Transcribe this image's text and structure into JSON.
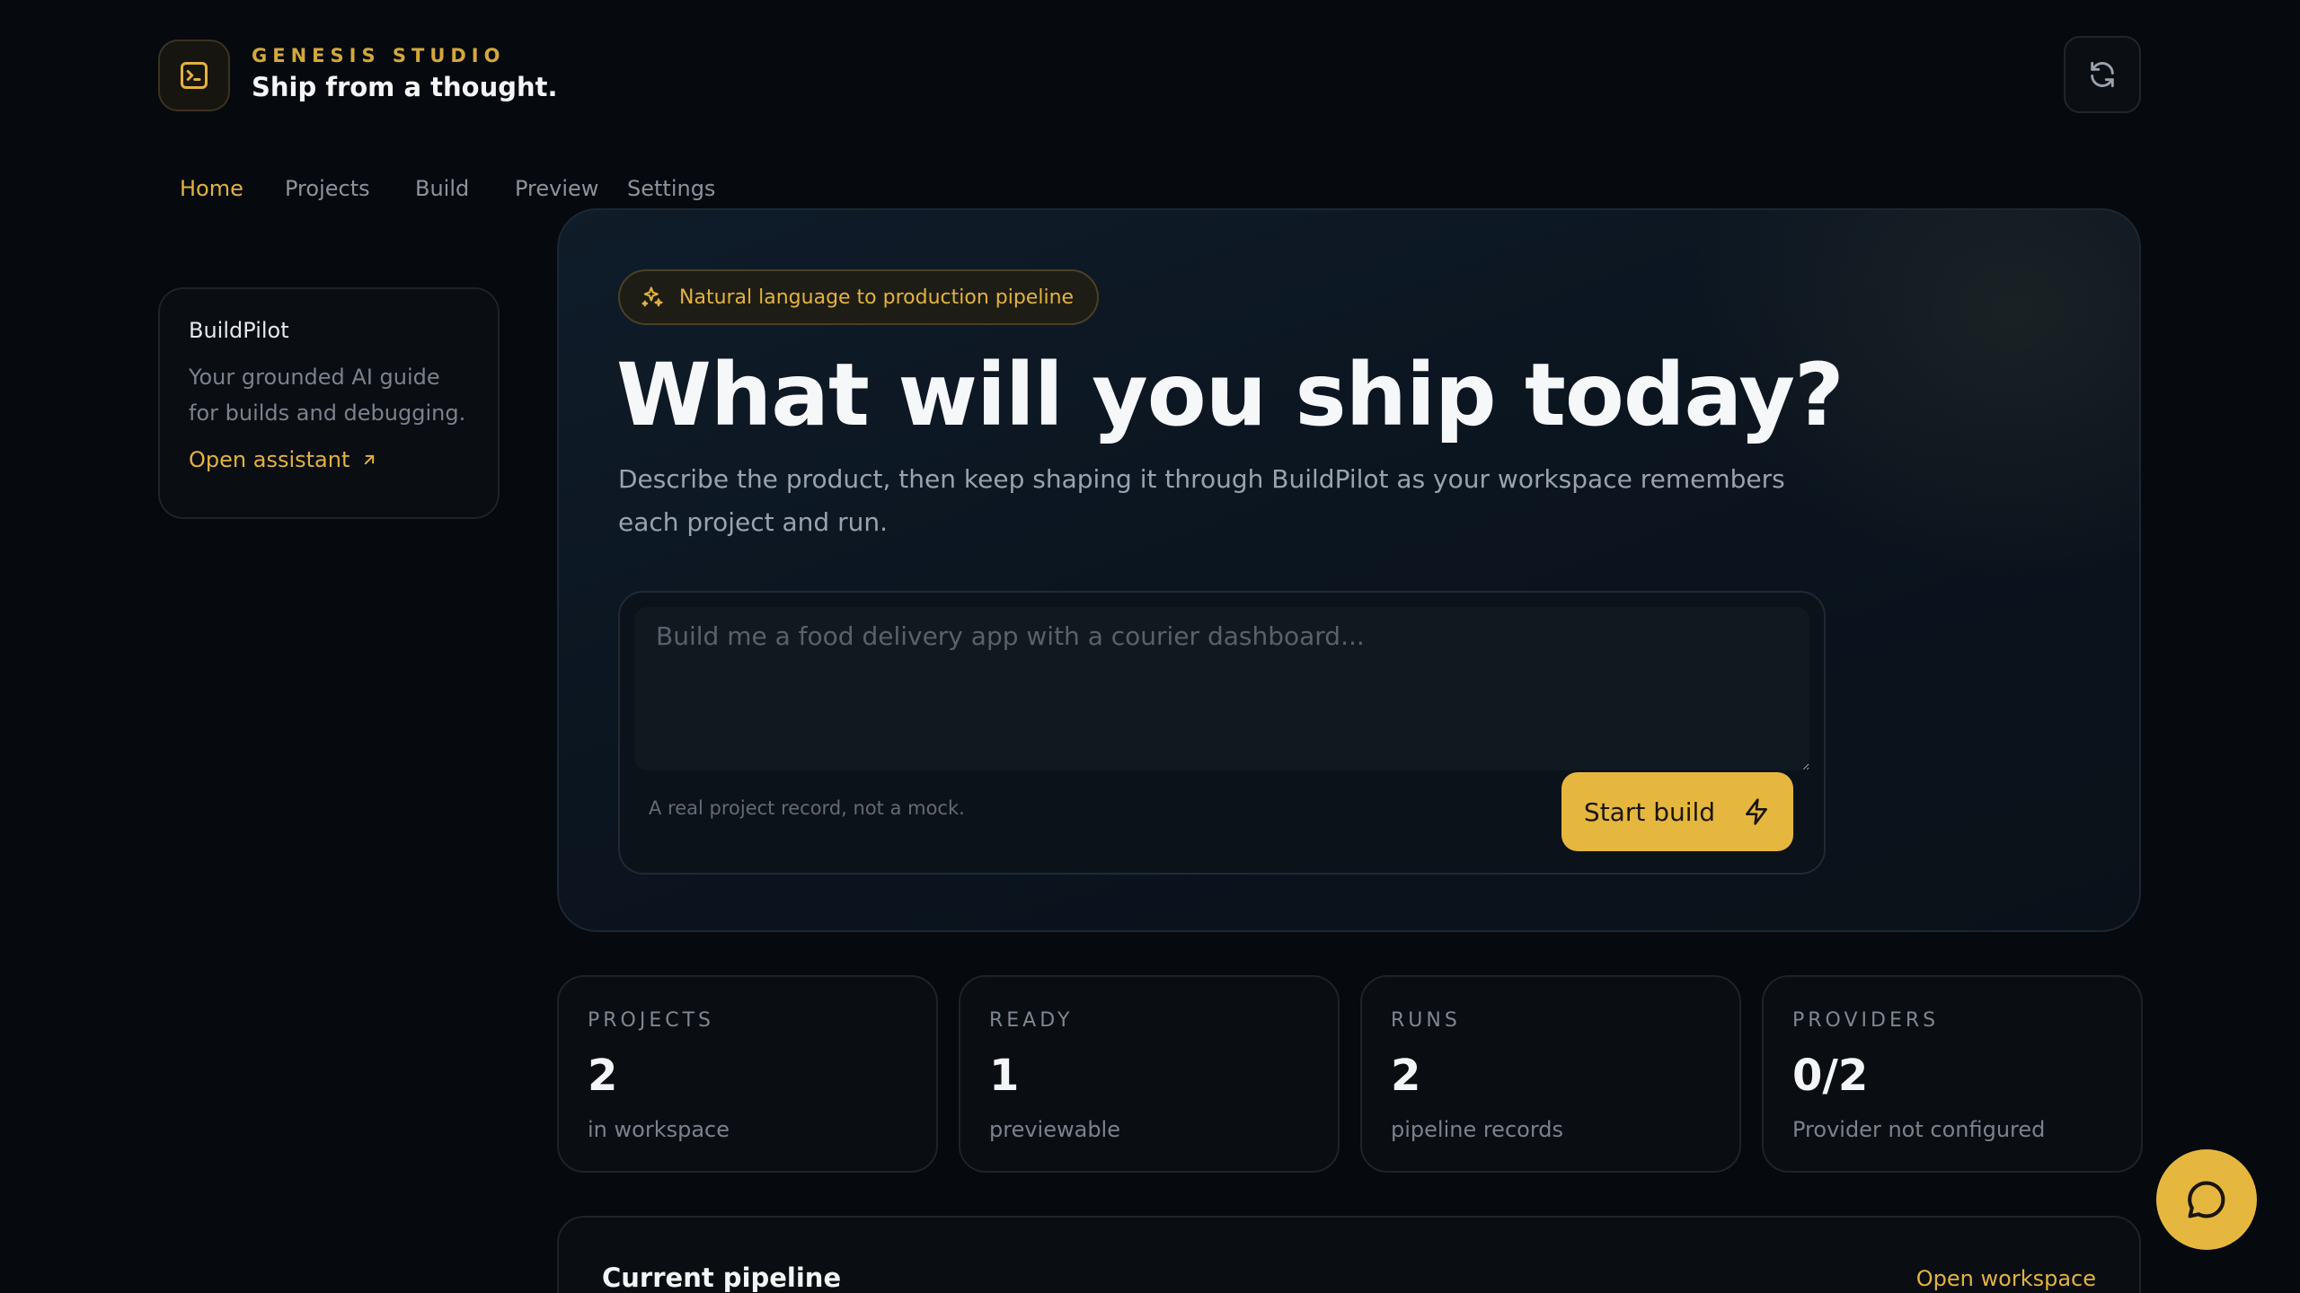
{
  "brand": {
    "eyebrow": "GENESIS STUDIO",
    "tagline": "Ship from a thought.",
    "logo_icon": "terminal-icon"
  },
  "header": {
    "refresh_icon": "refresh-icon"
  },
  "nav": {
    "items": [
      {
        "label": "Home",
        "active": true
      },
      {
        "label": "Projects",
        "active": false
      },
      {
        "label": "Build",
        "active": false
      },
      {
        "label": "Preview",
        "active": false
      },
      {
        "label": "Settings",
        "active": false
      }
    ]
  },
  "sidebar": {
    "title": "BuildPilot",
    "description": "Your grounded AI guide for builds and debugging.",
    "link_label": "Open assistant"
  },
  "hero": {
    "pill_label": "Natural language to production pipeline",
    "title": "What will you ship today?",
    "description": "Describe the product, then keep shaping it through BuildPilot as your workspace remembers each project and run.",
    "input_value": "",
    "input_placeholder": "Build me a food delivery app with a courier dashboard...",
    "note": "A real project record, not a mock.",
    "start_label": "Start build"
  },
  "stats": [
    {
      "label": "PROJECTS",
      "value": "2",
      "sub": "in workspace"
    },
    {
      "label": "READY",
      "value": "1",
      "sub": "previewable"
    },
    {
      "label": "RUNS",
      "value": "2",
      "sub": "pipeline records"
    },
    {
      "label": "PROVIDERS",
      "value": "0/2",
      "sub": "Provider not configured"
    }
  ],
  "pipeline": {
    "title": "Current pipeline",
    "link_label": "Open workspace"
  },
  "colors": {
    "background": "#06090d",
    "accent": "#e6b73e",
    "muted_text": "#7b828d"
  }
}
